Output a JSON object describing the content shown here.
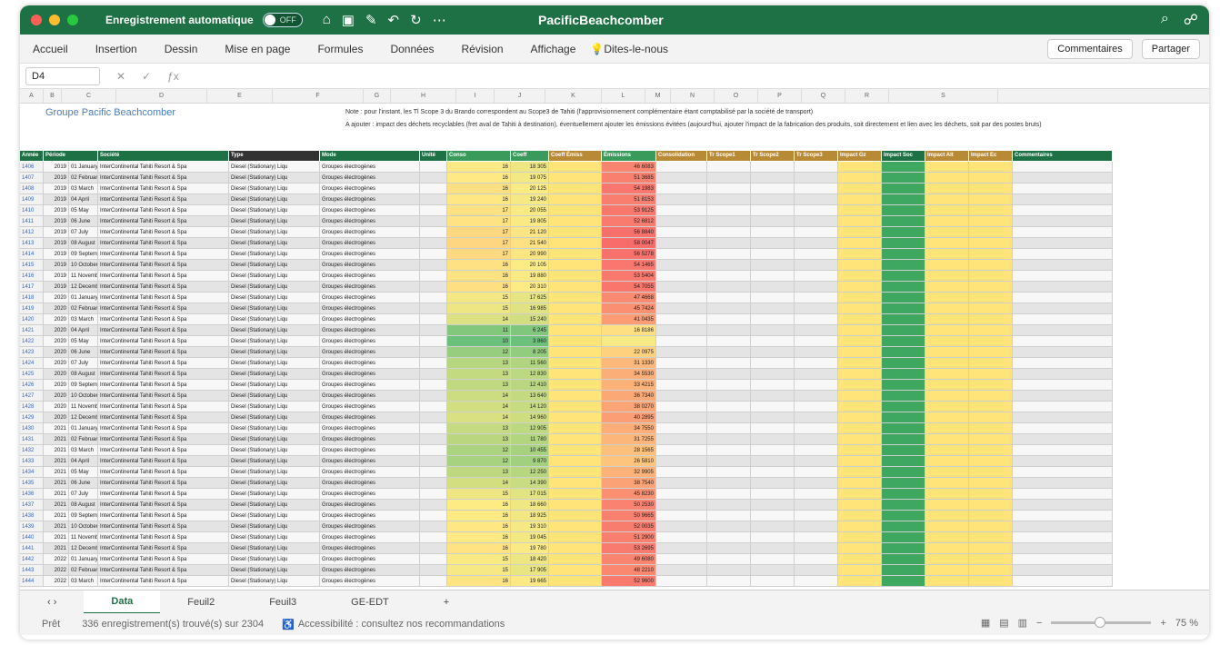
{
  "window": {
    "autosave_label": "Enregistrement automatique",
    "autosave_state": "OFF",
    "title": "PacificBeachcomber"
  },
  "ribbon": {
    "tabs": [
      "Accueil",
      "Insertion",
      "Dessin",
      "Mise en page",
      "Formules",
      "Données",
      "Révision",
      "Affichage"
    ],
    "tell_me": "Dites-le-nous",
    "comments": "Commentaires",
    "share": "Partager"
  },
  "formula_bar": {
    "cell_ref": "D4",
    "formula": ""
  },
  "columns": [
    "A",
    "B",
    "C",
    "D",
    "E",
    "F",
    "G",
    "H",
    "I",
    "J",
    "K",
    "L",
    "M",
    "N",
    "O",
    "P",
    "Q",
    "R",
    "S"
  ],
  "sheet": {
    "group_title": "Groupe Pacific Beachcomber",
    "note1": "Note : pour l'instant, les Tl Scope 3 du Brando correspondent au Scope3 de Tahiti (l'approvisionnement complémentaire étant comptabilisé par la société de transport)",
    "note2": "A ajouter : impact des déchets recyclables (fret aval de Tahiti à destination), éventuellement ajouter les émissions évitées (aujourd'hui, ajouter l'impact de la fabrication des produits, soit directement et lien avec les déchets, soit par des postes bruts)",
    "headers": [
      "Année",
      "Période",
      "Société",
      "Type",
      "Mode",
      "Unité",
      "Conso",
      "Coeff",
      "Coeff Émiss",
      "Émissions",
      "Consolidation",
      "Tr Scope1",
      "Tr Scope2",
      "Tr Scope3",
      "Impact Gz",
      "Impact Soc",
      "Impact Alt",
      "Impact Ec",
      "Commentaires"
    ],
    "company": "InterContinental Tahiti Resort & Spa",
    "fuel": "Diesel (Stationary) Liqu",
    "mode": "Groupes électrogènes",
    "rows": [
      {
        "n": "1406",
        "y": "2019",
        "p": "01 January",
        "v": "16",
        "q": "18 305",
        "e": "46 6083"
      },
      {
        "n": "1407",
        "y": "2019",
        "p": "02 February",
        "v": "16",
        "q": "19 075",
        "e": "51 3685"
      },
      {
        "n": "1408",
        "y": "2019",
        "p": "03 March",
        "v": "16",
        "q": "20 125",
        "e": "54 1983"
      },
      {
        "n": "1409",
        "y": "2019",
        "p": "04 April",
        "v": "16",
        "q": "19 240",
        "e": "51 8153"
      },
      {
        "n": "1410",
        "y": "2019",
        "p": "05 May",
        "v": "17",
        "q": "20 055",
        "e": "53 9125"
      },
      {
        "n": "1411",
        "y": "2019",
        "p": "06 June",
        "v": "17",
        "q": "19 805",
        "e": "52 6812"
      },
      {
        "n": "1412",
        "y": "2019",
        "p": "07 July",
        "v": "17",
        "q": "21 120",
        "e": "56 8840"
      },
      {
        "n": "1413",
        "y": "2019",
        "p": "08 August",
        "v": "17",
        "q": "21 540",
        "e": "58 0047"
      },
      {
        "n": "1414",
        "y": "2019",
        "p": "09 September",
        "v": "17",
        "q": "20 990",
        "e": "56 5278"
      },
      {
        "n": "1415",
        "y": "2019",
        "p": "10 October",
        "v": "16",
        "q": "20 105",
        "e": "54 1465"
      },
      {
        "n": "1416",
        "y": "2019",
        "p": "11 November",
        "v": "16",
        "q": "19 880",
        "e": "53 5404"
      },
      {
        "n": "1417",
        "y": "2019",
        "p": "12 December",
        "v": "16",
        "q": "20 310",
        "e": "54 7055"
      },
      {
        "n": "1418",
        "y": "2020",
        "p": "01 January",
        "v": "15",
        "q": "17 625",
        "e": "47 4668"
      },
      {
        "n": "1419",
        "y": "2020",
        "p": "02 February",
        "v": "15",
        "q": "16 985",
        "e": "45 7424"
      },
      {
        "n": "1420",
        "y": "2020",
        "p": "03 March",
        "v": "14",
        "q": "15 240",
        "e": "41 0435"
      },
      {
        "n": "1421",
        "y": "2020",
        "p": "04 April",
        "v": "11",
        "q": "6 245",
        "e": "16 8186"
      },
      {
        "n": "1422",
        "y": "2020",
        "p": "05 May",
        "v": "10",
        "q": "3 860",
        "e": ""
      },
      {
        "n": "1423",
        "y": "2020",
        "p": "06 June",
        "v": "12",
        "q": "8 205",
        "e": "22 0975"
      },
      {
        "n": "1424",
        "y": "2020",
        "p": "07 July",
        "v": "13",
        "q": "11 560",
        "e": "31 1330"
      },
      {
        "n": "1425",
        "y": "2020",
        "p": "08 August",
        "v": "13",
        "q": "12 830",
        "e": "34 5530"
      },
      {
        "n": "1426",
        "y": "2020",
        "p": "09 September",
        "v": "13",
        "q": "12 410",
        "e": "33 4215"
      },
      {
        "n": "1427",
        "y": "2020",
        "p": "10 October",
        "v": "14",
        "q": "13 640",
        "e": "36 7340"
      },
      {
        "n": "1428",
        "y": "2020",
        "p": "11 November",
        "v": "14",
        "q": "14 120",
        "e": "38 0270"
      },
      {
        "n": "1429",
        "y": "2020",
        "p": "12 December",
        "v": "14",
        "q": "14 960",
        "e": "40 2895"
      },
      {
        "n": "1430",
        "y": "2021",
        "p": "01 January",
        "v": "13",
        "q": "12 905",
        "e": "34 7550"
      },
      {
        "n": "1431",
        "y": "2021",
        "p": "02 February",
        "v": "13",
        "q": "11 780",
        "e": "31 7255"
      },
      {
        "n": "1432",
        "y": "2021",
        "p": "03 March",
        "v": "12",
        "q": "10 455",
        "e": "28 1565"
      },
      {
        "n": "1433",
        "y": "2021",
        "p": "04 April",
        "v": "12",
        "q": "9 870",
        "e": "26 5810"
      },
      {
        "n": "1434",
        "y": "2021",
        "p": "05 May",
        "v": "13",
        "q": "12 250",
        "e": "32 9905"
      },
      {
        "n": "1435",
        "y": "2021",
        "p": "06 June",
        "v": "14",
        "q": "14 390",
        "e": "38 7540"
      },
      {
        "n": "1436",
        "y": "2021",
        "p": "07 July",
        "v": "15",
        "q": "17 015",
        "e": "45 8230"
      },
      {
        "n": "1437",
        "y": "2021",
        "p": "08 August",
        "v": "16",
        "q": "18 660",
        "e": "50 2530"
      },
      {
        "n": "1438",
        "y": "2021",
        "p": "09 September",
        "v": "16",
        "q": "18 925",
        "e": "50 9665"
      },
      {
        "n": "1439",
        "y": "2021",
        "p": "10 October",
        "v": "16",
        "q": "19 310",
        "e": "52 0035"
      },
      {
        "n": "1440",
        "y": "2021",
        "p": "11 November",
        "v": "16",
        "q": "19 045",
        "e": "51 2900"
      },
      {
        "n": "1441",
        "y": "2021",
        "p": "12 December",
        "v": "16",
        "q": "19 780",
        "e": "53 2695"
      },
      {
        "n": "1442",
        "y": "2022",
        "p": "01 January",
        "v": "15",
        "q": "18 420",
        "e": "49 6080"
      },
      {
        "n": "1443",
        "y": "2022",
        "p": "02 February",
        "v": "15",
        "q": "17 905",
        "e": "48 2210"
      },
      {
        "n": "1444",
        "y": "2022",
        "p": "03 March",
        "v": "16",
        "q": "19 665",
        "e": "52 9600"
      }
    ]
  },
  "sheet_tabs": [
    "Data",
    "Feuil2",
    "Feuil3",
    "GE-EDT"
  ],
  "status": {
    "ready": "Prêt",
    "records": "336 enregistrement(s) trouvé(s) sur 2304",
    "accessibility": "Accessibilité : consultez nos recommandations",
    "zoom": "75 %"
  },
  "colors": {
    "excel_green": "#1e7145",
    "good": "#63be7b",
    "mid": "#ffeb84",
    "bad": "#f8696b"
  }
}
